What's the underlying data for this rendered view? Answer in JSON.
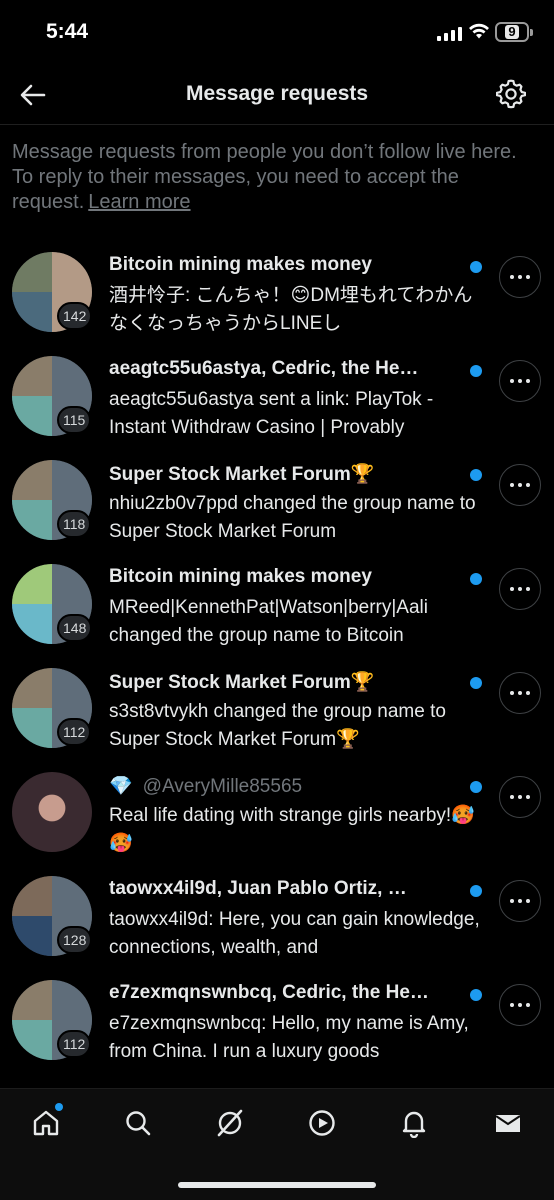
{
  "status_bar": {
    "time": "5:44",
    "battery_level": "9"
  },
  "header": {
    "title": "Message requests",
    "back_icon": "arrow-left-icon",
    "settings_icon": "gear-icon"
  },
  "intro": {
    "text": "Message requests from people you don’t follow live here. To reply to their messages, you need to accept the request.",
    "link": "Learn more"
  },
  "colors": {
    "accent": "#1d9bf0",
    "background": "#000000",
    "secondary_text": "#71767b"
  },
  "requests": [
    {
      "title": "Bitcoin mining makes money",
      "preview": "酒井怜子: こんちゃ！😊DM埋もれてわかんなくなっちゃうからLINEし",
      "count": "142",
      "unread": true
    },
    {
      "title": "aeagtc55u6astya, Cedric, the He…",
      "preview": "aeagtc55u6astya sent a link: PlayTok - Instant Withdraw Casino | Provably",
      "count": "115",
      "unread": true
    },
    {
      "title": "Super Stock Market Forum🏆",
      "preview": "nhiu2zb0v7ppd changed the group name to Super Stock Market Forum",
      "count": "118",
      "unread": true
    },
    {
      "title": "Bitcoin mining makes money",
      "preview": "MReed|KennethPat|Watson|berry|Aali changed the group name to Bitcoin",
      "count": "148",
      "unread": true
    },
    {
      "title": "Super Stock Market Forum🏆",
      "preview": "s3st8vtvykh changed the group name to Super Stock Market Forum🏆",
      "count": "112",
      "unread": true
    },
    {
      "handle_prefix": "💎",
      "title": "@AveryMille85565",
      "preview": "Real life dating with strange girls nearby!🥵🥵",
      "count": "",
      "unread": true
    },
    {
      "title": "taowxx4il9d, Juan Pablo Ortiz, …",
      "preview": "taowxx4il9d: Here, you can gain knowledge, connections, wealth, and",
      "count": "128",
      "unread": true
    },
    {
      "title": "e7zexmqnswnbcq, Cedric, the He…",
      "preview": "e7zexmqnswnbcq: Hello, my name is Amy, from China. I run a luxury goods",
      "count": "112",
      "unread": true
    }
  ],
  "tabbar": {
    "items": [
      {
        "name": "home",
        "icon": "home-icon",
        "has_notification_dot": true
      },
      {
        "name": "search",
        "icon": "search-icon"
      },
      {
        "name": "grok",
        "icon": "grok-icon"
      },
      {
        "name": "video",
        "icon": "play-icon"
      },
      {
        "name": "notifications",
        "icon": "bell-icon"
      },
      {
        "name": "messages",
        "icon": "mail-icon",
        "active": true
      }
    ]
  }
}
